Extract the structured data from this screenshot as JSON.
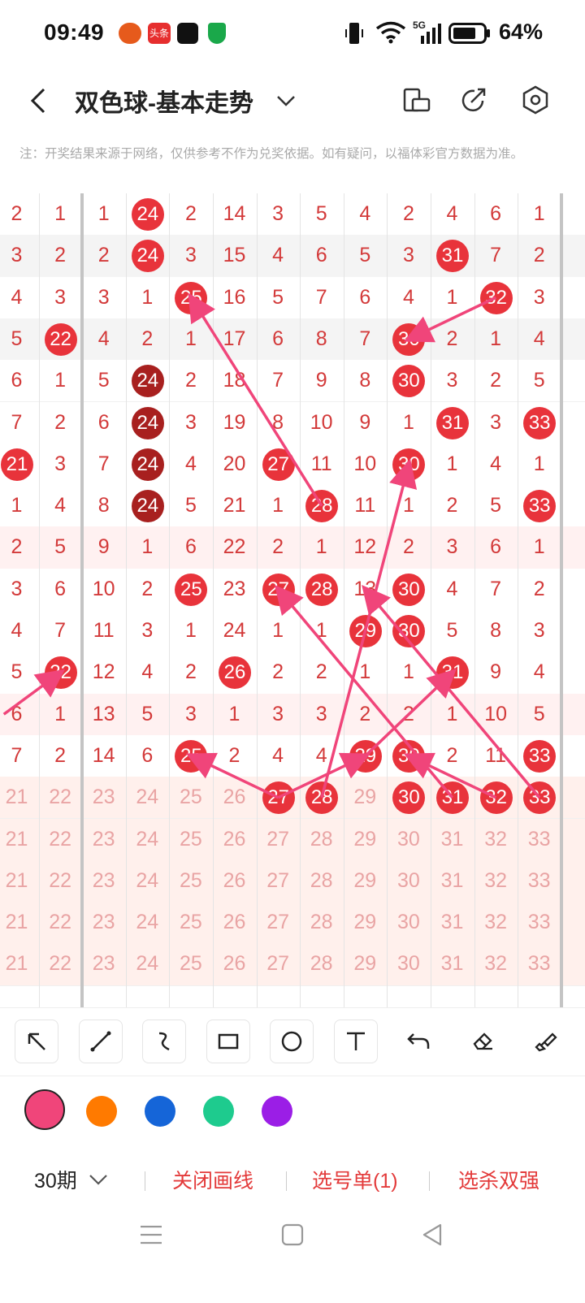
{
  "status": {
    "time": "09:49",
    "battery": "64%",
    "network": "5G",
    "notif_news": "头条"
  },
  "header": {
    "title": "双色球-基本走势"
  },
  "note": "注：开奖结果来源于网络，仅供参考不作为兑奖依据。如有疑问，以福体彩官方数据为准。",
  "grid": {
    "rows": [
      [
        "2",
        "1",
        "1",
        "24",
        "2",
        "14",
        "3",
        "5",
        "4",
        "2",
        "4",
        "6",
        "1"
      ],
      [
        "3",
        "2",
        "2",
        "24",
        "3",
        "15",
        "4",
        "6",
        "5",
        "3",
        "31",
        "7",
        "2"
      ],
      [
        "4",
        "3",
        "3",
        "1",
        "25",
        "16",
        "5",
        "7",
        "6",
        "4",
        "1",
        "32",
        "3"
      ],
      [
        "5",
        "22",
        "4",
        "2",
        "1",
        "17",
        "6",
        "8",
        "7",
        "30",
        "2",
        "1",
        "4"
      ],
      [
        "6",
        "1",
        "5",
        "24",
        "2",
        "18",
        "7",
        "9",
        "8",
        "30",
        "3",
        "2",
        "5"
      ],
      [
        "7",
        "2",
        "6",
        "24",
        "3",
        "19",
        "8",
        "10",
        "9",
        "1",
        "31",
        "3",
        "33"
      ],
      [
        "21",
        "3",
        "7",
        "24",
        "4",
        "20",
        "27",
        "11",
        "10",
        "30",
        "1",
        "4",
        "1"
      ],
      [
        "1",
        "4",
        "8",
        "24",
        "5",
        "21",
        "1",
        "28",
        "11",
        "1",
        "2",
        "5",
        "33"
      ],
      [
        "2",
        "5",
        "9",
        "1",
        "6",
        "22",
        "2",
        "1",
        "12",
        "2",
        "3",
        "6",
        "1"
      ],
      [
        "3",
        "6",
        "10",
        "2",
        "25",
        "23",
        "27",
        "28",
        "13",
        "30",
        "4",
        "7",
        "2"
      ],
      [
        "4",
        "7",
        "11",
        "3",
        "1",
        "24",
        "1",
        "1",
        "29",
        "30",
        "5",
        "8",
        "3"
      ],
      [
        "5",
        "22",
        "12",
        "4",
        "2",
        "26",
        "2",
        "2",
        "1",
        "1",
        "31",
        "9",
        "4"
      ],
      [
        "6",
        "1",
        "13",
        "5",
        "3",
        "1",
        "3",
        "3",
        "2",
        "2",
        "1",
        "10",
        "5"
      ],
      [
        "7",
        "2",
        "14",
        "6",
        "25",
        "2",
        "4",
        "4",
        "29",
        "30",
        "2",
        "11",
        "33"
      ],
      [
        "21",
        "22",
        "23",
        "24",
        "25",
        "26",
        "27",
        "28",
        "29",
        "30",
        "31",
        "32",
        "33"
      ],
      [
        "21",
        "22",
        "23",
        "24",
        "25",
        "26",
        "27",
        "28",
        "29",
        "30",
        "31",
        "32",
        "33"
      ],
      [
        "21",
        "22",
        "23",
        "24",
        "25",
        "26",
        "27",
        "28",
        "29",
        "30",
        "31",
        "32",
        "33"
      ],
      [
        "21",
        "22",
        "23",
        "24",
        "25",
        "26",
        "27",
        "28",
        "29",
        "30",
        "31",
        "32",
        "33"
      ],
      [
        "21",
        "22",
        "23",
        "24",
        "25",
        "26",
        "27",
        "28",
        "29",
        "30",
        "31",
        "32",
        "33"
      ]
    ],
    "balls": [
      [
        0,
        3,
        "red"
      ],
      [
        1,
        3,
        "red"
      ],
      [
        1,
        10,
        "red"
      ],
      [
        2,
        4,
        "red"
      ],
      [
        2,
        11,
        "red"
      ],
      [
        3,
        1,
        "red"
      ],
      [
        3,
        9,
        "red"
      ],
      [
        4,
        3,
        "dark"
      ],
      [
        4,
        9,
        "red"
      ],
      [
        5,
        3,
        "dark"
      ],
      [
        5,
        10,
        "red"
      ],
      [
        5,
        12,
        "red"
      ],
      [
        6,
        0,
        "red"
      ],
      [
        6,
        3,
        "dark"
      ],
      [
        6,
        6,
        "red"
      ],
      [
        6,
        9,
        "red"
      ],
      [
        7,
        3,
        "dark"
      ],
      [
        7,
        7,
        "red"
      ],
      [
        7,
        12,
        "red"
      ],
      [
        9,
        4,
        "red"
      ],
      [
        9,
        6,
        "red"
      ],
      [
        9,
        7,
        "red"
      ],
      [
        9,
        9,
        "red"
      ],
      [
        10,
        8,
        "red"
      ],
      [
        10,
        9,
        "red"
      ],
      [
        11,
        1,
        "red"
      ],
      [
        11,
        5,
        "red"
      ],
      [
        11,
        10,
        "red"
      ],
      [
        13,
        4,
        "red"
      ],
      [
        13,
        8,
        "red"
      ],
      [
        13,
        9,
        "red"
      ],
      [
        13,
        12,
        "red"
      ],
      [
        14,
        6,
        "red"
      ],
      [
        14,
        7,
        "red"
      ],
      [
        14,
        9,
        "red"
      ],
      [
        14,
        10,
        "red"
      ],
      [
        14,
        11,
        "red"
      ],
      [
        14,
        12,
        "red"
      ]
    ]
  },
  "tools": [
    "arrow-tool-icon",
    "line-tool-icon",
    "curve-tool-icon",
    "rect-tool-icon",
    "circle-tool-icon",
    "text-tool-icon",
    "undo-icon",
    "eraser-icon",
    "clear-brush-icon"
  ],
  "colors": [
    "#f0457a",
    "#ff7a00",
    "#1565d8",
    "#1ecb8e",
    "#9b1ee6"
  ],
  "bottom": {
    "period": "30期",
    "close_draw": "关闭画线",
    "selection": "选号单(1)",
    "kill_double": "选杀双强"
  }
}
